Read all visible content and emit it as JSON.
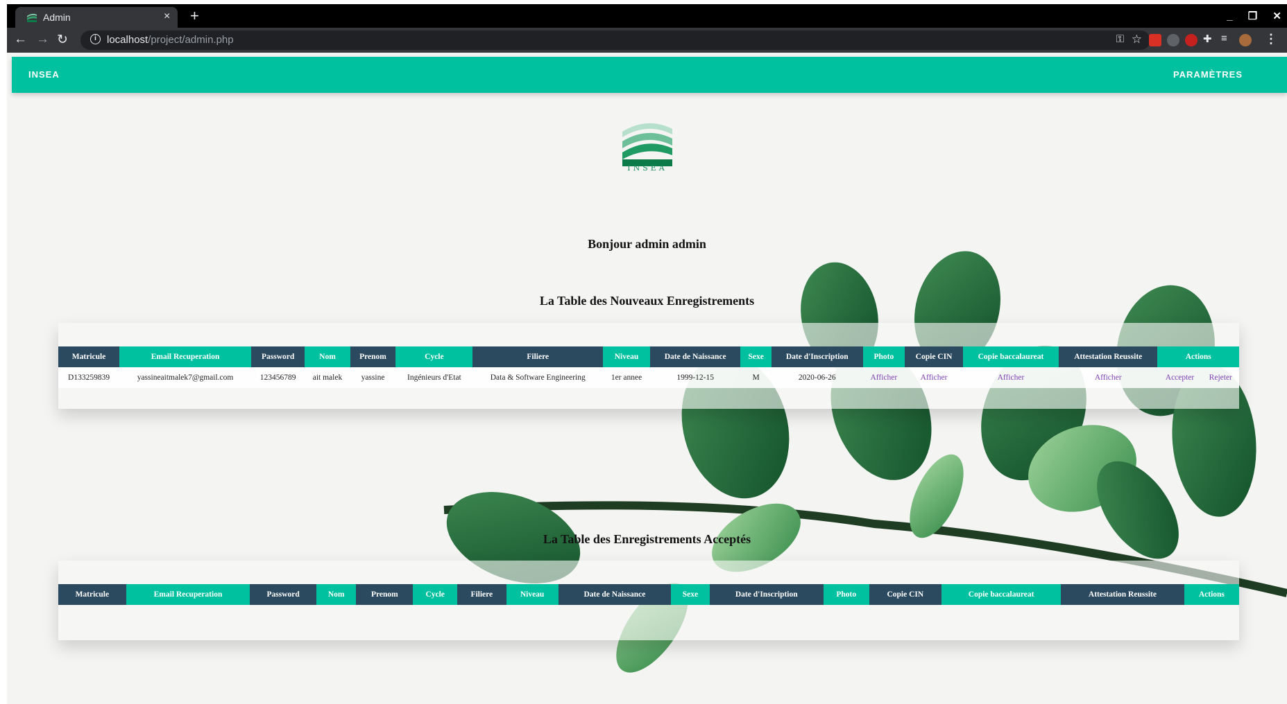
{
  "browser": {
    "tab_title": "Admin",
    "tab_close": "×",
    "new_tab": "+",
    "url_host": "localhost",
    "url_path": "/project/admin.php",
    "window_controls": [
      "_",
      "❐",
      "✕"
    ]
  },
  "navbar": {
    "brand": "INSEA",
    "settings": "PARAMÈTRES"
  },
  "logo": {
    "text": "INSEA"
  },
  "greeting": "Bonjour admin admin",
  "new_table": {
    "title": "La Table des Nouveaux Enregistrements",
    "headers": [
      "Matricule",
      "Email Recuperation",
      "Password",
      "Nom",
      "Prenom",
      "Cycle",
      "Filiere",
      "Niveau",
      "Date de Naissance",
      "Sexe",
      "Date d'Inscription",
      "Photo",
      "Copie CIN",
      "Copie baccalaureat",
      "Attestation Reussite",
      "Actions"
    ],
    "rows": [
      {
        "matricule": "D133259839",
        "email": "yassineaitmalek7@gmail.com",
        "password": "123456789",
        "nom": "ait malek",
        "prenom": "yassine",
        "cycle": "Ingénieurs d'Etat",
        "filiere": "Data & Software Engineering",
        "niveau": "1er annee",
        "date_naissance": "1999-12-15",
        "sexe": "M",
        "date_inscription": "2020-06-26",
        "photo": "Afficher",
        "copie_cin": "Afficher",
        "copie_bac": "Afficher",
        "attestation": "Afficher",
        "accept": "Accepter",
        "reject": "Rejeter"
      }
    ]
  },
  "accepted_table": {
    "title": "La Table des Enregistrements Acceptés",
    "headers": [
      "Matricule",
      "Email Recuperation",
      "Password",
      "Nom",
      "Prenom",
      "Cycle",
      "Filiere",
      "Niveau",
      "Date de Naissance",
      "Sexe",
      "Date d'Inscription",
      "Photo",
      "Copie CIN",
      "Copie baccalaureat",
      "Attestation Reussite",
      "Actions"
    ]
  },
  "colors": {
    "accent": "#00c19f",
    "dark_header": "#2c4a5f",
    "link": "#7b3fb0"
  }
}
